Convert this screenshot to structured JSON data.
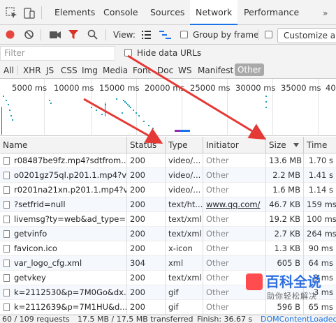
{
  "tabs": {
    "elements": "Elements",
    "console": "Console",
    "sources": "Sources",
    "network": "Network",
    "performance": "Performance",
    "more": "»"
  },
  "toolbar": {
    "view_label": "View:",
    "group_by_frame": "Group by frame",
    "customize": "Customize and"
  },
  "filter": {
    "placeholder": "Filter",
    "hide_data_urls": "Hide data URLs"
  },
  "type_filters": [
    "All",
    "XHR",
    "JS",
    "CSS",
    "Img",
    "Media",
    "Font",
    "Doc",
    "WS",
    "Manifest",
    "Other"
  ],
  "overview": {
    "ticks": [
      "5000 ms",
      "10000 ms",
      "15000 ms",
      "20000 ms",
      "25000 ms",
      "30000 ms",
      "35000 ms",
      "40"
    ]
  },
  "columns": {
    "name": "Name",
    "status": "Status",
    "type": "Type",
    "initiator": "Initiator",
    "size": "Size",
    "time": "Time"
  },
  "rows": [
    {
      "name": "r08487be9fz.mp4?sdtfrom...",
      "status": "200",
      "type": "video/...",
      "initiator": "Other",
      "size": "13.6 MB",
      "time": "1.70 s"
    },
    {
      "name": "o0201gz75ql.p201.1.mp4?v...",
      "status": "200",
      "type": "video/...",
      "initiator": "Other",
      "size": "2.2 MB",
      "time": "1.41 s"
    },
    {
      "name": "r0201na21xn.p201.1.mp4?v...",
      "status": "200",
      "type": "video/...",
      "initiator": "Other",
      "size": "1.6 MB",
      "time": "1.14 s"
    },
    {
      "name": "?setfrid=null",
      "status": "200",
      "type": "text/ht...",
      "initiator": "www.qq.com/",
      "size": "46.7 KB",
      "time": "159 ms"
    },
    {
      "name": "livemsg?ty=web&ad_type=...",
      "status": "200",
      "type": "text/xml",
      "initiator": "Other",
      "size": "19.2 KB",
      "time": "100 ms"
    },
    {
      "name": "getvinfo",
      "status": "200",
      "type": "text/xml",
      "initiator": "Other",
      "size": "2.7 KB",
      "time": "264 ms"
    },
    {
      "name": "favicon.ico",
      "status": "200",
      "type": "x-icon",
      "initiator": "Other",
      "size": "1.3 KB",
      "time": "90 ms"
    },
    {
      "name": "var_logo_cfg.xml",
      "status": "304",
      "type": "xml",
      "initiator": "Other",
      "size": "605 B",
      "time": "64 ms"
    },
    {
      "name": "getvkey",
      "status": "200",
      "type": "text/xml",
      "initiator": "Other",
      "size": "",
      "time": "3 ms"
    },
    {
      "name": "k=2112530&p=7M0Go&dx...",
      "status": "200",
      "type": "gif",
      "initiator": "Other",
      "size": "",
      "time": "3 ms"
    },
    {
      "name": "k=2112639&p=7M1HU&d...",
      "status": "200",
      "type": "gif",
      "initiator": "Other",
      "size": "596 B",
      "time": "65 ms"
    }
  ],
  "statusbar": {
    "requests": "60 / 109 requests",
    "transferred": "17.5 MB / 17.5 MB transferred",
    "finish": "Finish: 36.67 s",
    "dcl": "DOMContentLoaded"
  },
  "watermark": {
    "title": "百科全说",
    "subtitle": "助你轻松解决"
  },
  "colors": {
    "record": "#e8453c",
    "filter_active": "#d93025",
    "accent": "#1a73e8",
    "annotation_arrow": "#e53935"
  }
}
